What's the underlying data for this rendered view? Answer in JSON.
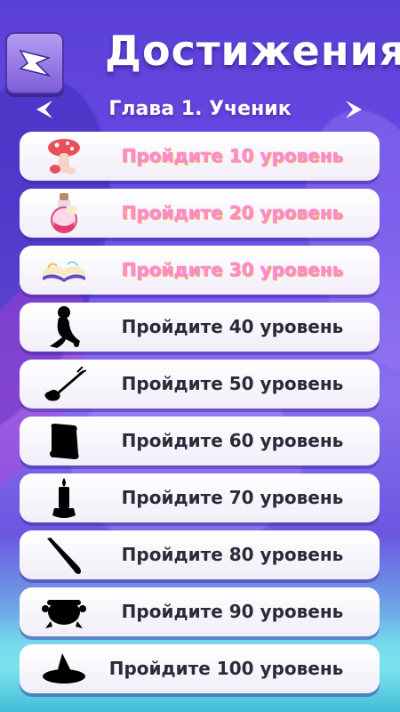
{
  "header": {
    "title": "Достижения",
    "chapter": "Глава 1. Ученик"
  },
  "achievements": [
    {
      "label": "Пройдите 10 уровень",
      "unlocked": true,
      "icon": "mushroom-icon"
    },
    {
      "label": "Пройдите 20 уровень",
      "unlocked": true,
      "icon": "potion-icon"
    },
    {
      "label": "Пройдите 30 уровень",
      "unlocked": true,
      "icon": "book-icon"
    },
    {
      "label": "Пройдите 40 уровень",
      "unlocked": false,
      "icon": "figure-silhouette-icon"
    },
    {
      "label": "Пройдите 50 уровень",
      "unlocked": false,
      "icon": "broom-silhouette-icon"
    },
    {
      "label": "Пройдите 60 уровень",
      "unlocked": false,
      "icon": "scroll-silhouette-icon"
    },
    {
      "label": "Пройдите 70 уровень",
      "unlocked": false,
      "icon": "candle-silhouette-icon"
    },
    {
      "label": "Пройдите 80 уровень",
      "unlocked": false,
      "icon": "wand-silhouette-icon"
    },
    {
      "label": "Пройдите 90 уровень",
      "unlocked": false,
      "icon": "cauldron-silhouette-icon"
    },
    {
      "label": "Пройдите 100 уровень",
      "unlocked": false,
      "icon": "witch-hat-silhouette-icon"
    }
  ],
  "colors": {
    "unlocked_text": "#ff8ad0",
    "locked_text": "#2a2a3a"
  }
}
